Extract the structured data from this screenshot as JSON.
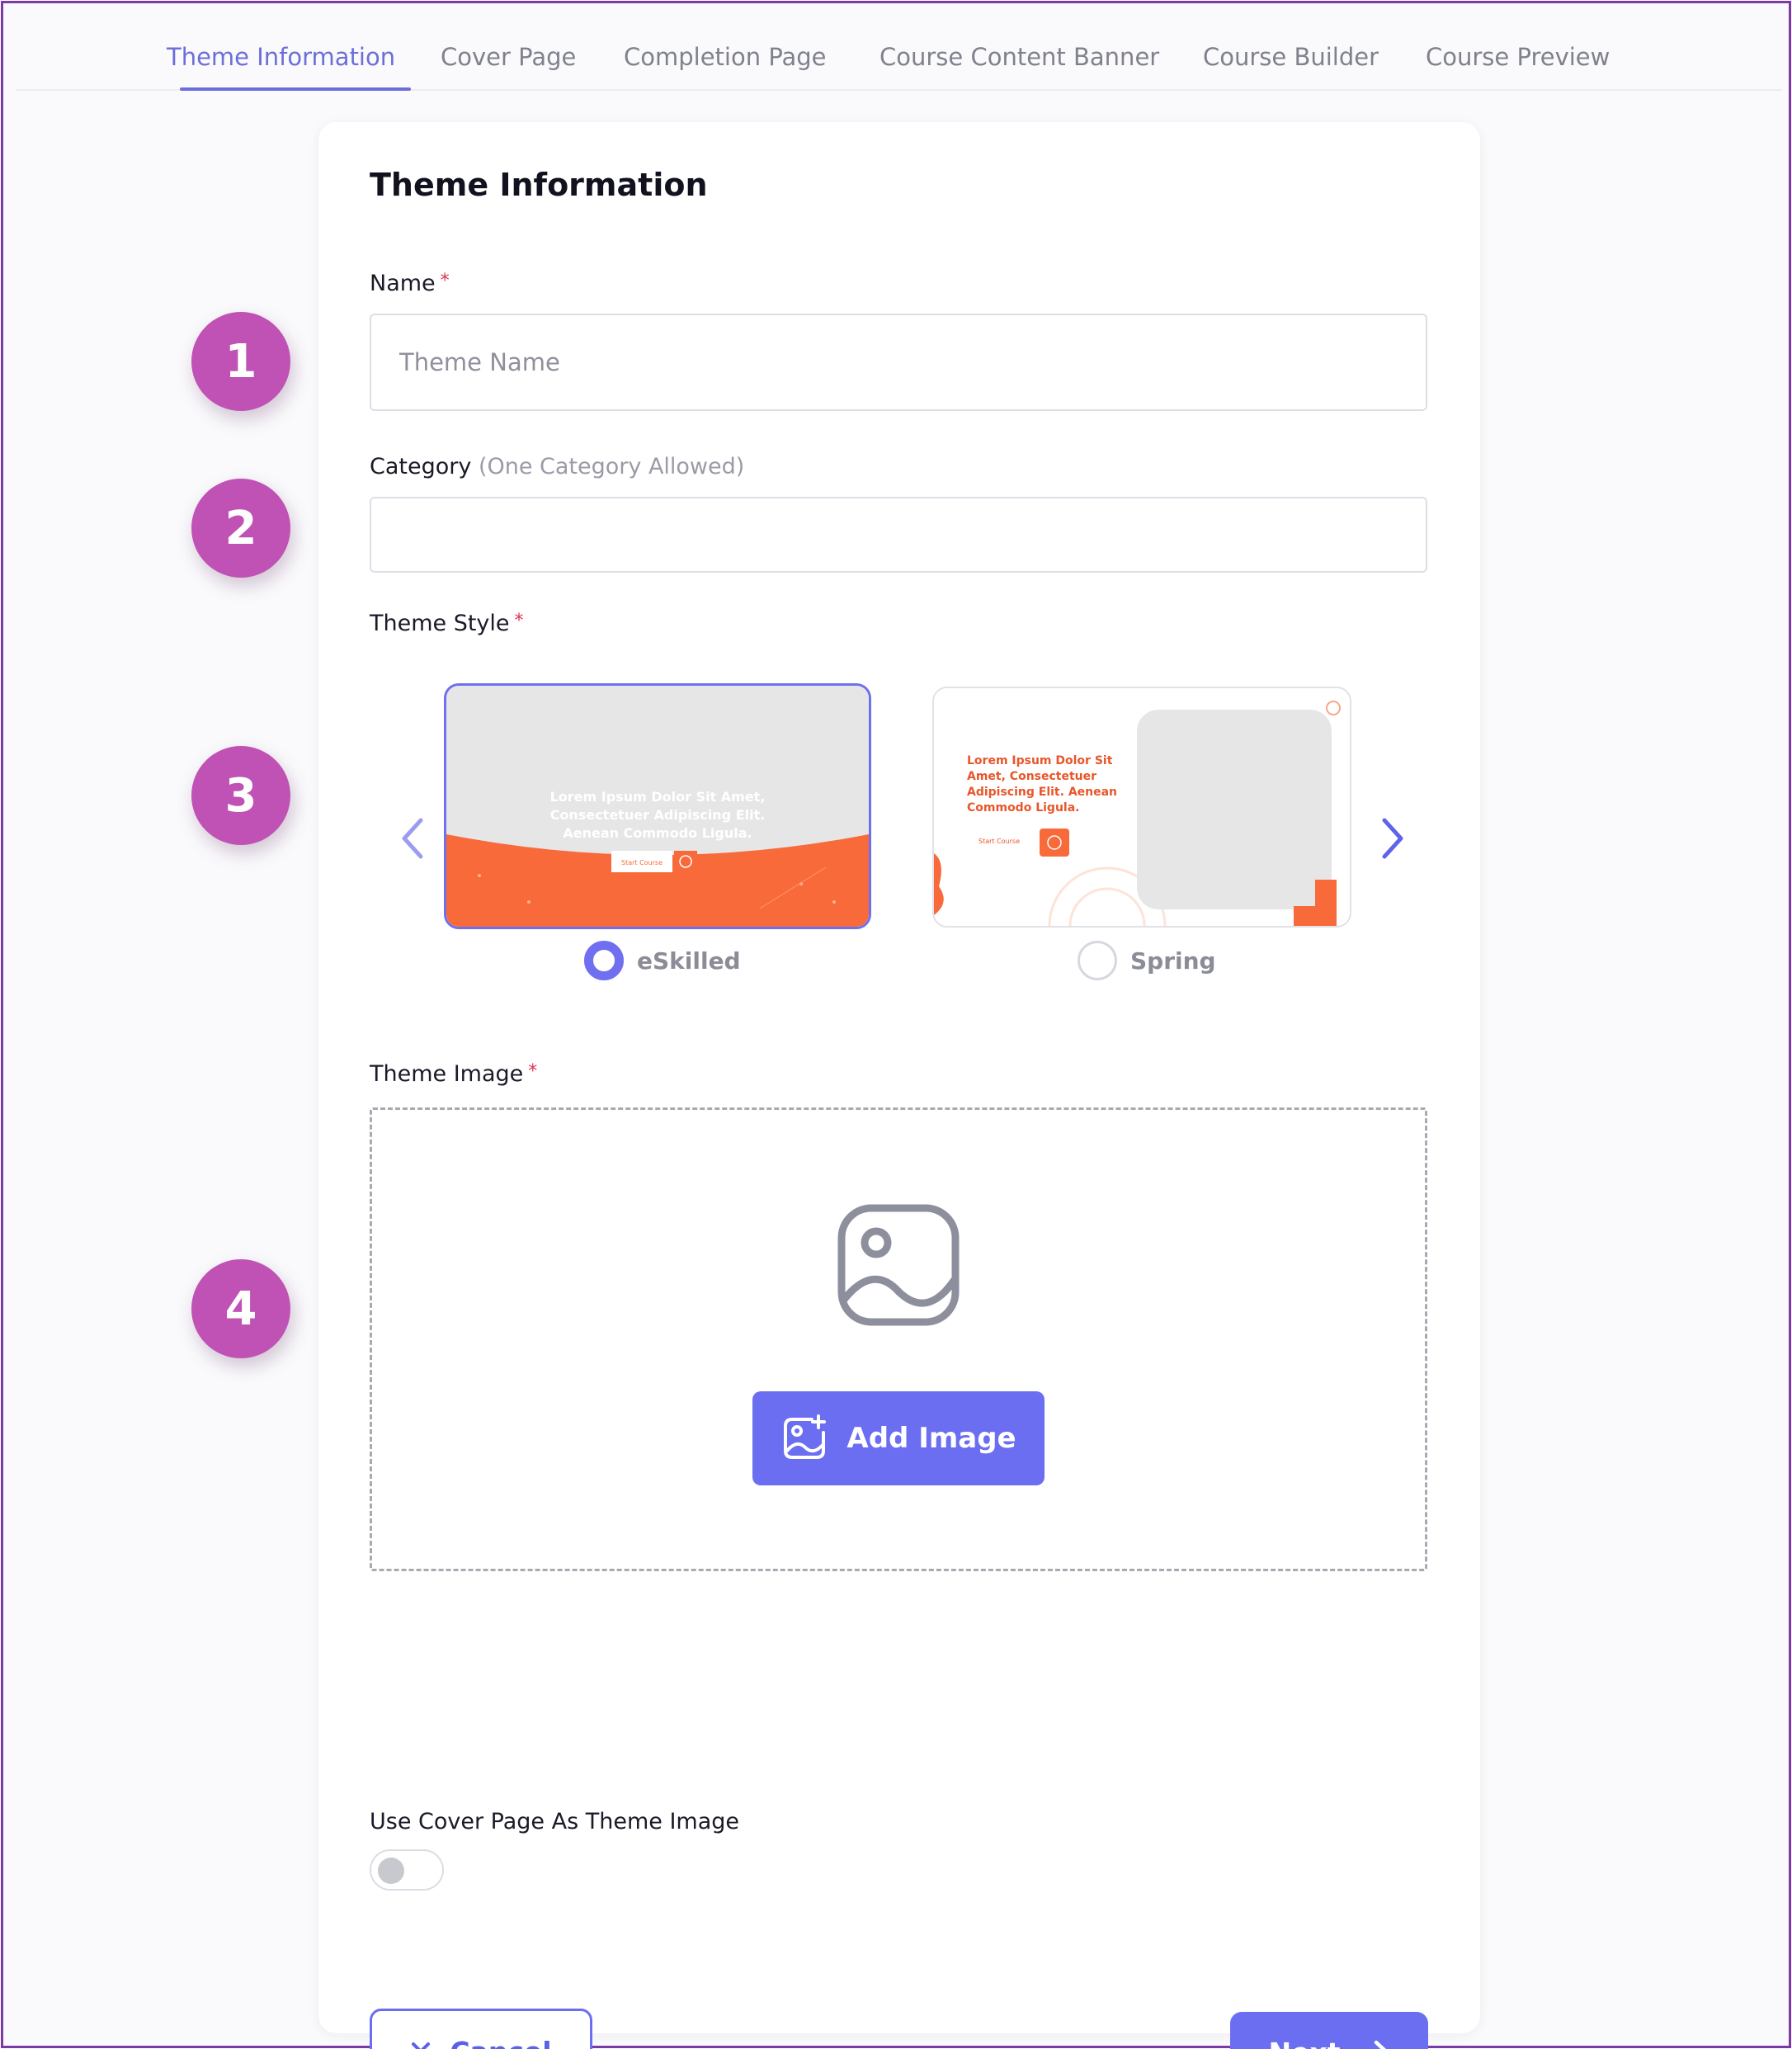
{
  "tabs": [
    {
      "label": "Theme Information",
      "active": true
    },
    {
      "label": "Cover Page",
      "active": false
    },
    {
      "label": "Completion Page",
      "active": false
    },
    {
      "label": "Course Content Banner",
      "active": false
    },
    {
      "label": "Course Builder",
      "active": false
    },
    {
      "label": "Course Preview",
      "active": false
    }
  ],
  "card": {
    "title": "Theme Information",
    "name_field": {
      "label": "Name",
      "required_mark": "*",
      "placeholder": "Theme Name",
      "value": ""
    },
    "category_field": {
      "label": "Category",
      "hint": "(One Category Allowed)",
      "value": ""
    },
    "theme_style": {
      "label": "Theme Style",
      "required_mark": "*",
      "options": [
        {
          "name": "eSkilled",
          "selected": true,
          "preview_text": "Lorem Ipsum Dolor Sit Amet, Consectetuer Adipiscing Elit. Aenean Commodo Ligula.",
          "preview_button": "Start Course"
        },
        {
          "name": "Spring",
          "selected": false,
          "preview_text": "Lorem Ipsum Dolor Sit Amet, Consectetuer Adipiscing Elit. Aenean Commodo Ligula.",
          "preview_button": "Start Course"
        }
      ]
    },
    "theme_image": {
      "label": "Theme Image",
      "required_mark": "*",
      "add_button": "Add Image"
    },
    "cover_toggle": {
      "label": "Use Cover Page As Theme Image",
      "on": false
    },
    "cancel_label": "Cancel",
    "next_label": "Next"
  },
  "step_badges": [
    "1",
    "2",
    "3",
    "4"
  ],
  "colors": {
    "accent": "#6b6ef0",
    "badge": "#bf52b4",
    "required": "#e0314b",
    "eskilled_orange": "#f86a3a",
    "frame_border": "#7b3aa8"
  }
}
